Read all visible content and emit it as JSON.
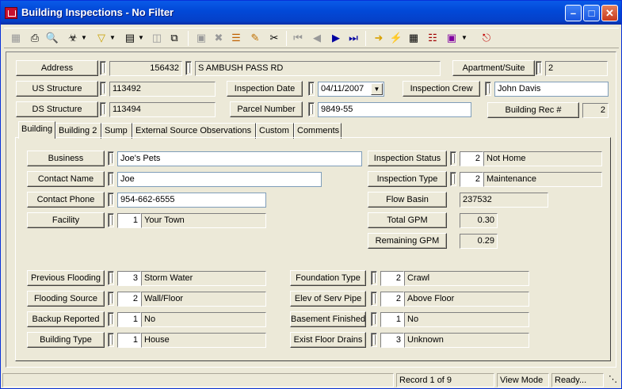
{
  "window": {
    "title": "Building Inspections - No Filter"
  },
  "header": {
    "address": {
      "label": "Address",
      "number": "156432",
      "street": "S AMBUSH PASS RD"
    },
    "apartment": {
      "label": "Apartment/Suite",
      "value": "2"
    },
    "us_structure": {
      "label": "US Structure",
      "value": "113492"
    },
    "inspection_date": {
      "label": "Inspection Date",
      "value": "04/11/2007"
    },
    "inspection_crew": {
      "label": "Inspection Crew",
      "value": "John Davis"
    },
    "ds_structure": {
      "label": "DS Structure",
      "value": "113494"
    },
    "parcel_number": {
      "label": "Parcel Number",
      "value": "9849-55"
    },
    "building_rec": {
      "label": "Building Rec #",
      "value": "2"
    }
  },
  "tabs": [
    "Building",
    "Building 2",
    "Sump",
    "External Source Observations",
    "Custom",
    "Comments"
  ],
  "building": {
    "business": {
      "label": "Business",
      "value": "Joe's Pets"
    },
    "contact_name": {
      "label": "Contact Name",
      "value": "Joe"
    },
    "contact_phone": {
      "label": "Contact Phone",
      "value": "954-662-6555"
    },
    "facility": {
      "label": "Facility",
      "code": "1",
      "value": "Your Town"
    },
    "inspection_status": {
      "label": "Inspection Status",
      "code": "2",
      "value": "Not Home"
    },
    "inspection_type": {
      "label": "Inspection Type",
      "code": "2",
      "value": "Maintenance"
    },
    "flow_basin": {
      "label": "Flow Basin",
      "value": "237532"
    },
    "total_gpm": {
      "label": "Total GPM",
      "value": "0.30"
    },
    "remaining_gpm": {
      "label": "Remaining GPM",
      "value": "0.29"
    },
    "previous_flooding": {
      "label": "Previous Flooding",
      "code": "3",
      "value": "Storm Water"
    },
    "flooding_source": {
      "label": "Flooding Source",
      "code": "2",
      "value": "Wall/Floor"
    },
    "backup_reported": {
      "label": "Backup Reported",
      "code": "1",
      "value": "No"
    },
    "building_type": {
      "label": "Building Type",
      "code": "1",
      "value": "House"
    },
    "foundation_type": {
      "label": "Foundation Type",
      "code": "2",
      "value": "Crawl"
    },
    "elev_serv_pipe": {
      "label": "Elev of Serv Pipe",
      "code": "2",
      "value": "Above Floor"
    },
    "basement_finished": {
      "label": "Basement Finished",
      "code": "1",
      "value": "No"
    },
    "exist_floor_drains": {
      "label": "Exist Floor Drains",
      "code": "3",
      "value": "Unknown"
    }
  },
  "status": {
    "record": "Record 1 of 9",
    "mode": "View Mode",
    "state": "Ready..."
  }
}
